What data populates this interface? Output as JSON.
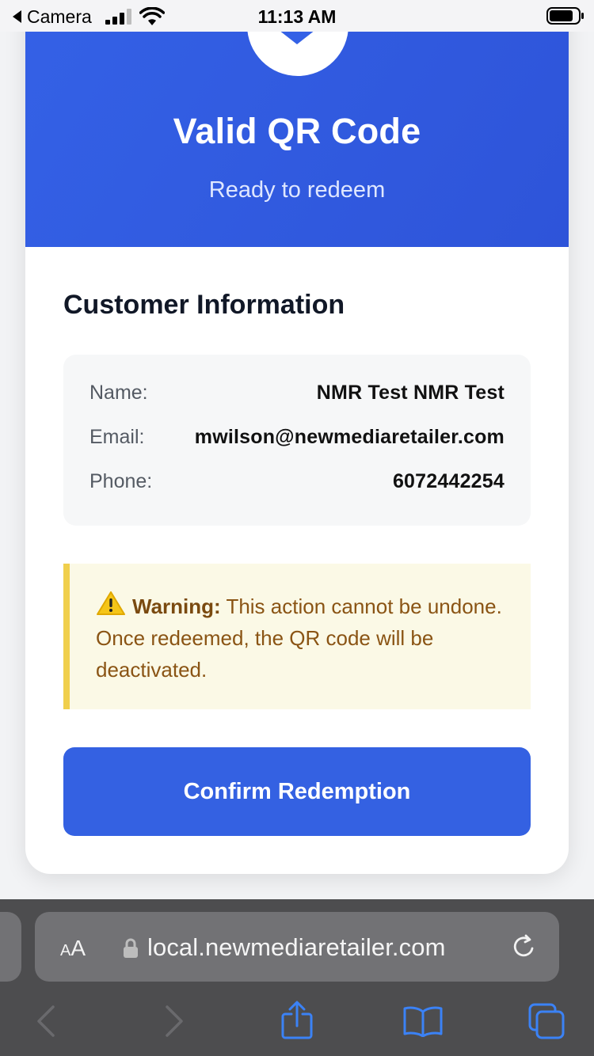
{
  "status_bar": {
    "back_app": "Camera",
    "time": "11:13 AM"
  },
  "hero": {
    "title": "Valid QR Code",
    "subtitle": "Ready to redeem",
    "accent_color": "#3461e6",
    "icon": "checkmark-icon"
  },
  "customer": {
    "section_title": "Customer Information",
    "rows": [
      {
        "label": "Name:",
        "value": "NMR Test NMR Test"
      },
      {
        "label": "Email:",
        "value": "mwilson@newmediaretailer.com"
      },
      {
        "label": "Phone:",
        "value": "6072442254"
      }
    ]
  },
  "warning": {
    "icon": "warning-triangle-icon",
    "label": "Warning:",
    "message": " This action cannot be undone. Once redeemed, the QR code will be deactivated.",
    "border_color": "#f0cf4c"
  },
  "actions": {
    "confirm_label": "Confirm Redemption",
    "button_color": "#3461e2"
  },
  "browser": {
    "aa_small": "A",
    "aa_big": "A",
    "url": "local.newmediaretailer.com"
  }
}
